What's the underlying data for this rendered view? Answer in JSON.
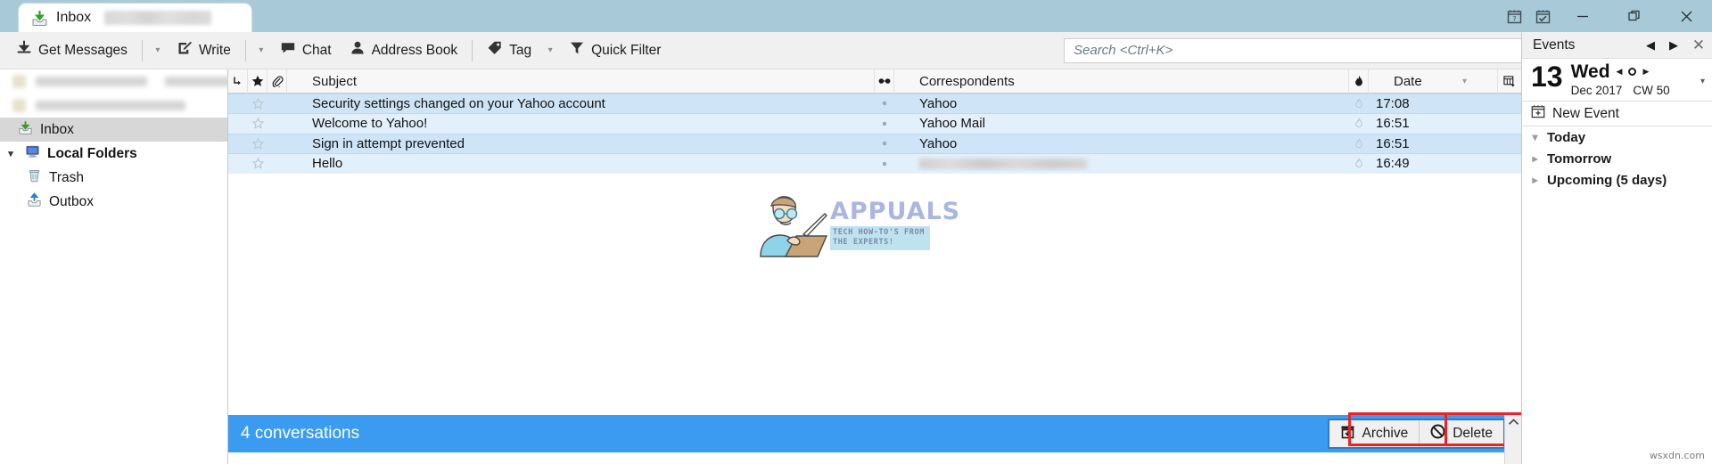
{
  "window": {
    "tab_label": "Inbox",
    "tab_icon": "inbox-download-icon",
    "controls": {
      "calendar": "calendar-icon",
      "tasks": "tasks-icon",
      "minimize": "—",
      "maximize": "❐",
      "close": "✕"
    }
  },
  "toolbar": {
    "get_messages": "Get Messages",
    "write": "Write",
    "chat": "Chat",
    "address_book": "Address Book",
    "tag": "Tag",
    "quick_filter": "Quick Filter",
    "caret": "▾",
    "search_placeholder": "Search <Ctrl+K>",
    "search_value": "",
    "search_icon": "magnifier-icon",
    "menu_icon": "hamburger-menu-icon"
  },
  "sidebar": {
    "items": [
      {
        "label": "Inbox",
        "icon": "inbox-icon",
        "selected": true,
        "level": "child"
      },
      {
        "label": "Local Folders",
        "icon": "local-folders-icon",
        "selected": false,
        "level": "root"
      },
      {
        "label": "Trash",
        "icon": "trash-icon",
        "selected": false,
        "level": "child"
      },
      {
        "label": "Outbox",
        "icon": "outbox-icon",
        "selected": false,
        "level": "child"
      }
    ]
  },
  "message_list": {
    "columns": {
      "thread": "thread-icon",
      "star": "star-icon",
      "attachment": "paperclip-icon",
      "subject": "Subject",
      "read": "read-glasses-icon",
      "correspondents": "Correspondents",
      "junk": "junk-flame-icon",
      "date": "Date",
      "sort_caret": "▾",
      "column_picker": "column-picker-icon"
    },
    "rows": [
      {
        "subject": "Security settings changed on your Yahoo account",
        "correspondent": "Yahoo",
        "correspondent_redacted": false,
        "date": "17:08"
      },
      {
        "subject": "Welcome to Yahoo!",
        "correspondent": "Yahoo Mail",
        "correspondent_redacted": false,
        "date": "16:51"
      },
      {
        "subject": "Sign in attempt prevented",
        "correspondent": "Yahoo",
        "correspondent_redacted": false,
        "date": "16:51"
      },
      {
        "subject": "Hello",
        "correspondent": "",
        "correspondent_redacted": true,
        "date": "16:49"
      }
    ]
  },
  "watermark": {
    "brand": "APPUALS",
    "tagline_line1": "TECH HOW-TO'S FROM",
    "tagline_line2": "THE EXPERTS!",
    "corner": "wsxdn.com"
  },
  "status_bar": {
    "text": "4 conversations",
    "background": "#3b9bf0",
    "archive_label": "Archive",
    "archive_icon": "archive-box-icon",
    "delete_label": "Delete",
    "delete_icon": "no-entry-icon",
    "highlight_color": "#e8232a",
    "scroll_up_icon": "chevron-up-icon"
  },
  "events_pane": {
    "title": "Events",
    "prev_icon": "◀",
    "next_icon": "▶",
    "close_icon": "✕",
    "day_number": "13",
    "day_of_week": "Wed",
    "month_year": "Dec 2017",
    "calendar_week": "CW 50",
    "new_event": "New Event",
    "new_event_icon": "new-event-calendar-icon",
    "groups": [
      {
        "label": "Today",
        "expanded": true
      },
      {
        "label": "Tomorrow",
        "expanded": false
      },
      {
        "label": "Upcoming (5 days)",
        "expanded": false
      }
    ]
  }
}
